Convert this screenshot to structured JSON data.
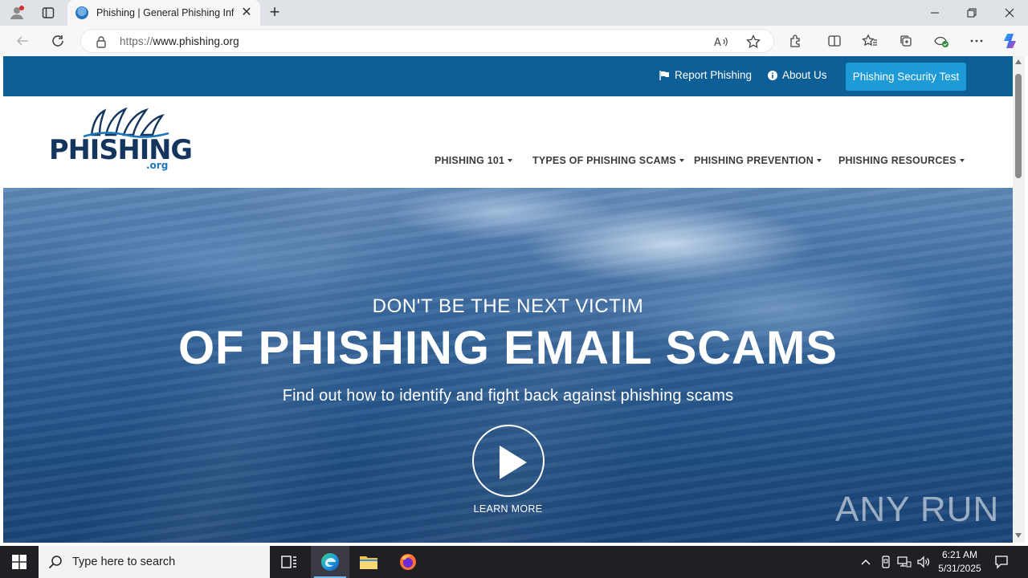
{
  "browser": {
    "tab_title": "Phishing | General Phishing Information",
    "url_scheme": "https://",
    "url_host": "www.phishing.org"
  },
  "site": {
    "top_links": {
      "report": "Report Phishing",
      "about": "About Us",
      "cta": "Phishing Security Test"
    },
    "logo": {
      "word": "PHISHING",
      "tld": ".org"
    },
    "menu": [
      {
        "label": "PHISHING 101"
      },
      {
        "label": "TYPES OF PHISHING SCAMS"
      },
      {
        "label": "PHISHING PREVENTION"
      },
      {
        "label": "PHISHING RESOURCES"
      }
    ],
    "hero": {
      "kicker": "DON'T BE THE NEXT VICTIM",
      "title": "OF PHISHING EMAIL SCAMS",
      "subtitle": "Find out how to identify and fight back against phishing scams",
      "learn_more": "LEARN MORE"
    },
    "watermark": "ANY RUN"
  },
  "taskbar": {
    "search_placeholder": "Type here to search",
    "time": "6:21 AM",
    "date": "5/31/2025"
  },
  "colors": {
    "topbar": "#0d5f96",
    "cta": "#1c9bd6",
    "logo_navy": "#14365e"
  }
}
